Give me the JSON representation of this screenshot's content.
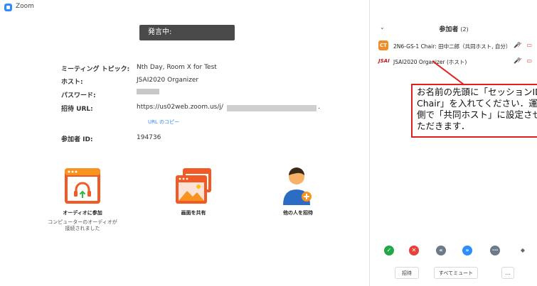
{
  "window": {
    "title": "Zoom",
    "minimize": "–",
    "maximize": "□",
    "close": "✕"
  },
  "main": {
    "speaking_badge": "発言中:",
    "info": [
      {
        "label": "ミーティング トピック:",
        "value": "Nth Day, Room X for Test"
      },
      {
        "label": "ホスト:",
        "value": "JSAI2020 Organizer"
      },
      {
        "label": "パスワード:",
        "value": ""
      },
      {
        "label": "招待 URL:",
        "value": "https://us02web.zoom.us/j/"
      },
      {
        "label": "参加者 ID:",
        "value": "194736"
      }
    ],
    "url_tail": ".",
    "copy_url": "URL のコピー",
    "actions": {
      "join_audio": "オーディオに参加",
      "join_audio_sub": "コンピューターのオーディオが\n接続されました",
      "share_screen": "画面を共有",
      "invite": "他の人を招待"
    }
  },
  "participants_panel": {
    "title": "参加者",
    "count": "(2)",
    "participants": [
      {
        "avatar": "CT",
        "name": "2N6-GS-1 Chair: 田中二郎（共同ホスト, 自分）",
        "avatar_color": "#f28c28"
      },
      {
        "avatar": "JSAI",
        "name": "JSAI2020 Organizer (ホスト)",
        "avatar_color": "#ffffff"
      }
    ],
    "callout": [
      "お名前の先頭に「セッションID",
      "Chair」を入れてください．運営",
      "側で「共同ホスト」に設定させ",
      "ただきます．"
    ],
    "buttons": {
      "invite": "招待",
      "mute_all": "すべてミュート",
      "more": "..."
    }
  },
  "colors": {
    "accent": "#2d8cff",
    "callout_border": "#e02020",
    "speaking_bg": "#4a4a4a"
  }
}
